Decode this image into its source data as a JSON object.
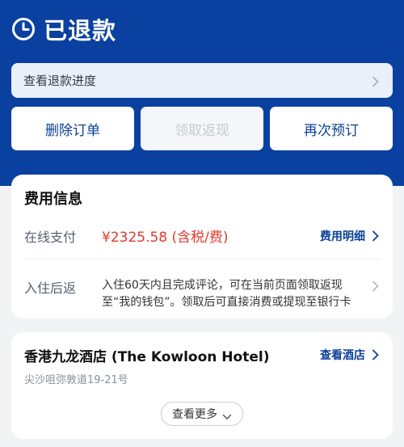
{
  "header": {
    "title": "已退款",
    "icon": "clock-icon",
    "background_color": "#0a41a0"
  },
  "progress": {
    "label": "查看退款进度",
    "icon": "chevron-right-icon"
  },
  "actions": [
    {
      "label": "删除订单",
      "enabled": true
    },
    {
      "label": "领取返现",
      "enabled": false
    },
    {
      "label": "再次预订",
      "enabled": true
    }
  ],
  "fee_card": {
    "title": "费用信息",
    "payment": {
      "label": "在线支付",
      "amount": "¥2325.58 (含税/费)",
      "detail_link": "费用明细"
    },
    "rebate": {
      "label": "入住后返",
      "text": "入住60天内且完成评论，可在当前页面领取返现至“我的钱包”。领取后可直接消费或提现至银行卡"
    }
  },
  "hotel_card": {
    "name": "香港九龙酒店 (The Kowloon Hotel)",
    "link": "查看酒店",
    "address": "尖沙咀弥敦道19-21号",
    "more_button": "查看更多"
  },
  "colors": {
    "accent": "#0a3f95",
    "price": "#e23a2e"
  }
}
